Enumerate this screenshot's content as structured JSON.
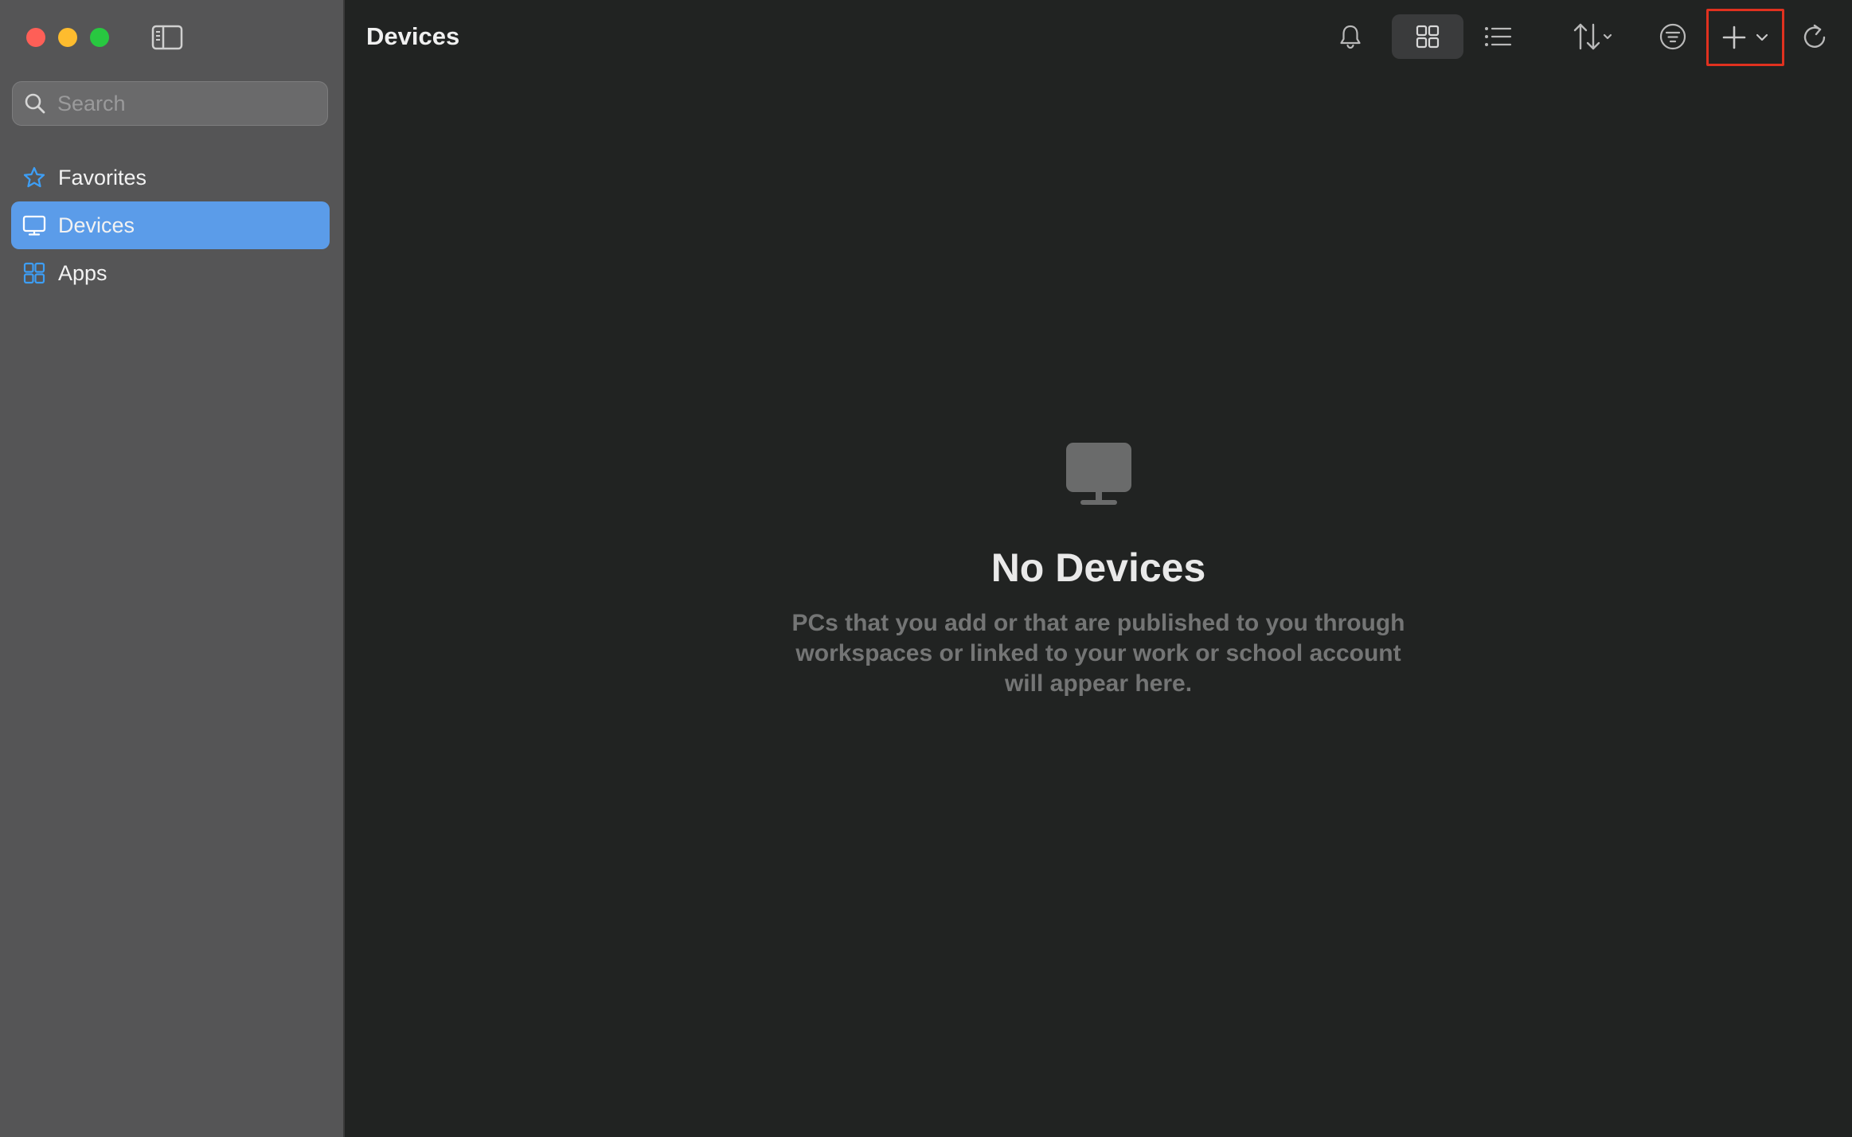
{
  "window": {
    "traffic_lights": {
      "close": "#fe5f57",
      "minimize": "#febc2e",
      "zoom": "#28c840"
    }
  },
  "sidebar": {
    "search": {
      "placeholder": "Search",
      "value": ""
    },
    "items": [
      {
        "label": "Favorites",
        "icon": "star-icon",
        "active": false
      },
      {
        "label": "Devices",
        "icon": "monitor-icon",
        "active": true
      },
      {
        "label": "Apps",
        "icon": "apps-grid-icon",
        "active": false
      }
    ],
    "accent_color": "#5b9ce9"
  },
  "main": {
    "title": "Devices",
    "toolbar": [
      {
        "name": "notifications-button",
        "icon": "bell-icon"
      },
      {
        "name": "grid-view-button",
        "icon": "grid-icon",
        "selected": true
      },
      {
        "name": "list-view-button",
        "icon": "list-icon"
      },
      {
        "name": "sort-button",
        "icon": "sort-arrows-icon"
      },
      {
        "name": "filter-button",
        "icon": "filter-icon"
      },
      {
        "name": "add-button",
        "icon": "plus-icon",
        "highlighted": true
      },
      {
        "name": "refresh-button",
        "icon": "refresh-icon"
      }
    ],
    "empty_state": {
      "icon": "monitor-icon",
      "title": "No Devices",
      "description": "PCs that you add or that are published to you through workspaces or linked to your work or school account will appear here."
    },
    "highlight_color": "#e0311f"
  }
}
